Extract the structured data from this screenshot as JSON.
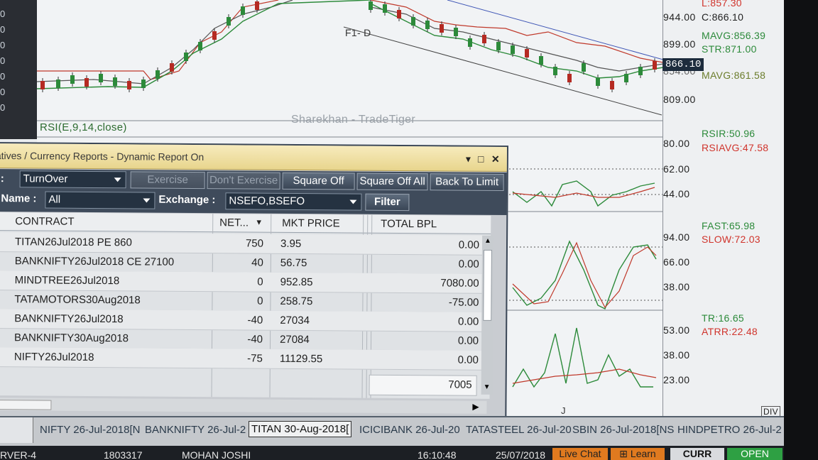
{
  "left_strip_glyphs": [
    "0",
    "0",
    "0",
    "0",
    "0",
    "0",
    "0",
    "0",
    "0"
  ],
  "chart": {
    "watermark": "Sharekhan - TradeTiger",
    "drawing_label": "F1- D",
    "rsi_label": "RSI(E,9,14,close)",
    "price_tag": "866.10",
    "x_axis_label": "J",
    "div_label": "DIV"
  },
  "price_axis": {
    "ticks": [
      "944.00",
      "899.00",
      "854.00",
      "809.00"
    ],
    "rsi_ticks": [
      "80.00",
      "62.00",
      "44.00"
    ],
    "stoch_ticks": [
      "94.00",
      "66.00",
      "38.00"
    ],
    "atr_ticks": [
      "53.00",
      "38.00",
      "23.00"
    ]
  },
  "indicators": {
    "low": "L:857.30",
    "close": "C:866.10",
    "mavg1": "MAVG:856.39",
    "str": "STR:871.00",
    "mavg2": "MAVG:861.58",
    "rsir": "RSIR:50.96",
    "rsiavg": "RSIAVG:47.58",
    "fast": "FAST:65.98",
    "slow": "SLOW:72.03",
    "tr": "TR:16.65",
    "atrr": "ATRR:22.48"
  },
  "report_window": {
    "title": "atives / Currency Reports - Dynamic Report On",
    "report_type_label": "t :",
    "report_type_value": "TurnOver",
    "name_label": "Name :",
    "name_value": "All",
    "exchange_label": "Exchange :",
    "exchange_value": "NSEFO,BSEFO",
    "buttons": {
      "exercise": "Exercise",
      "dont_exercise": "Don't Exercise",
      "square_off": "Square Off",
      "square_off_all": "Square Off All",
      "back_to_limit": "Back To Limit",
      "filter": "Filter"
    },
    "columns": [
      "CONTRACT",
      "NET...",
      "MKT PRICE",
      "TOTAL BPL"
    ],
    "rows": [
      {
        "contract": "TITAN26Jul2018 PE 860",
        "net": "750",
        "mkt_price": "3.95",
        "total_bpl": "0.00"
      },
      {
        "contract": "BANKNIFTY26Jul2018 CE 27100",
        "net": "40",
        "mkt_price": "56.75",
        "total_bpl": "0.00"
      },
      {
        "contract": "MINDTREE26Jul2018",
        "net": "0",
        "mkt_price": "952.85",
        "total_bpl": "7080.00"
      },
      {
        "contract": "TATAMOTORS30Aug2018",
        "net": "0",
        "mkt_price": "258.75",
        "total_bpl": "-75.00"
      },
      {
        "contract": "BANKNIFTY26Jul2018",
        "net": "-40",
        "mkt_price": "27034",
        "total_bpl": "0.00"
      },
      {
        "contract": "BANKNIFTY30Aug2018",
        "net": "-40",
        "mkt_price": "27084",
        "total_bpl": "0.00"
      },
      {
        "contract": "NIFTY26Jul2018",
        "net": "-75",
        "mkt_price": "11129.55",
        "total_bpl": "0.00"
      }
    ],
    "total": "7005"
  },
  "ticker_tabs": [
    "NIFTY 26-Jul-2018[N",
    "BANKNIFTY 26-Jul-2",
    "TITAN 30-Aug-2018[",
    "ICICIBANK 26-Jul-20",
    "TATASTEEL 26-Jul-20",
    "SBIN 26-Jul-2018[NS",
    "HINDPETRO 26-Jul-2"
  ],
  "status_bar": {
    "server": "RVER-4",
    "client_id": "1803317",
    "user": "MOHAN  JOSHI",
    "time": "16:10:48",
    "date": "25/07/2018",
    "live_chat": "Live Chat",
    "learn": "Learn",
    "curr": "CURR",
    "open": "OPEN"
  },
  "colors": {
    "green": "#2c8a3a",
    "red": "#d0342c",
    "toolbar": "#3f4b5b",
    "titlebar": "#ecdc9d"
  }
}
